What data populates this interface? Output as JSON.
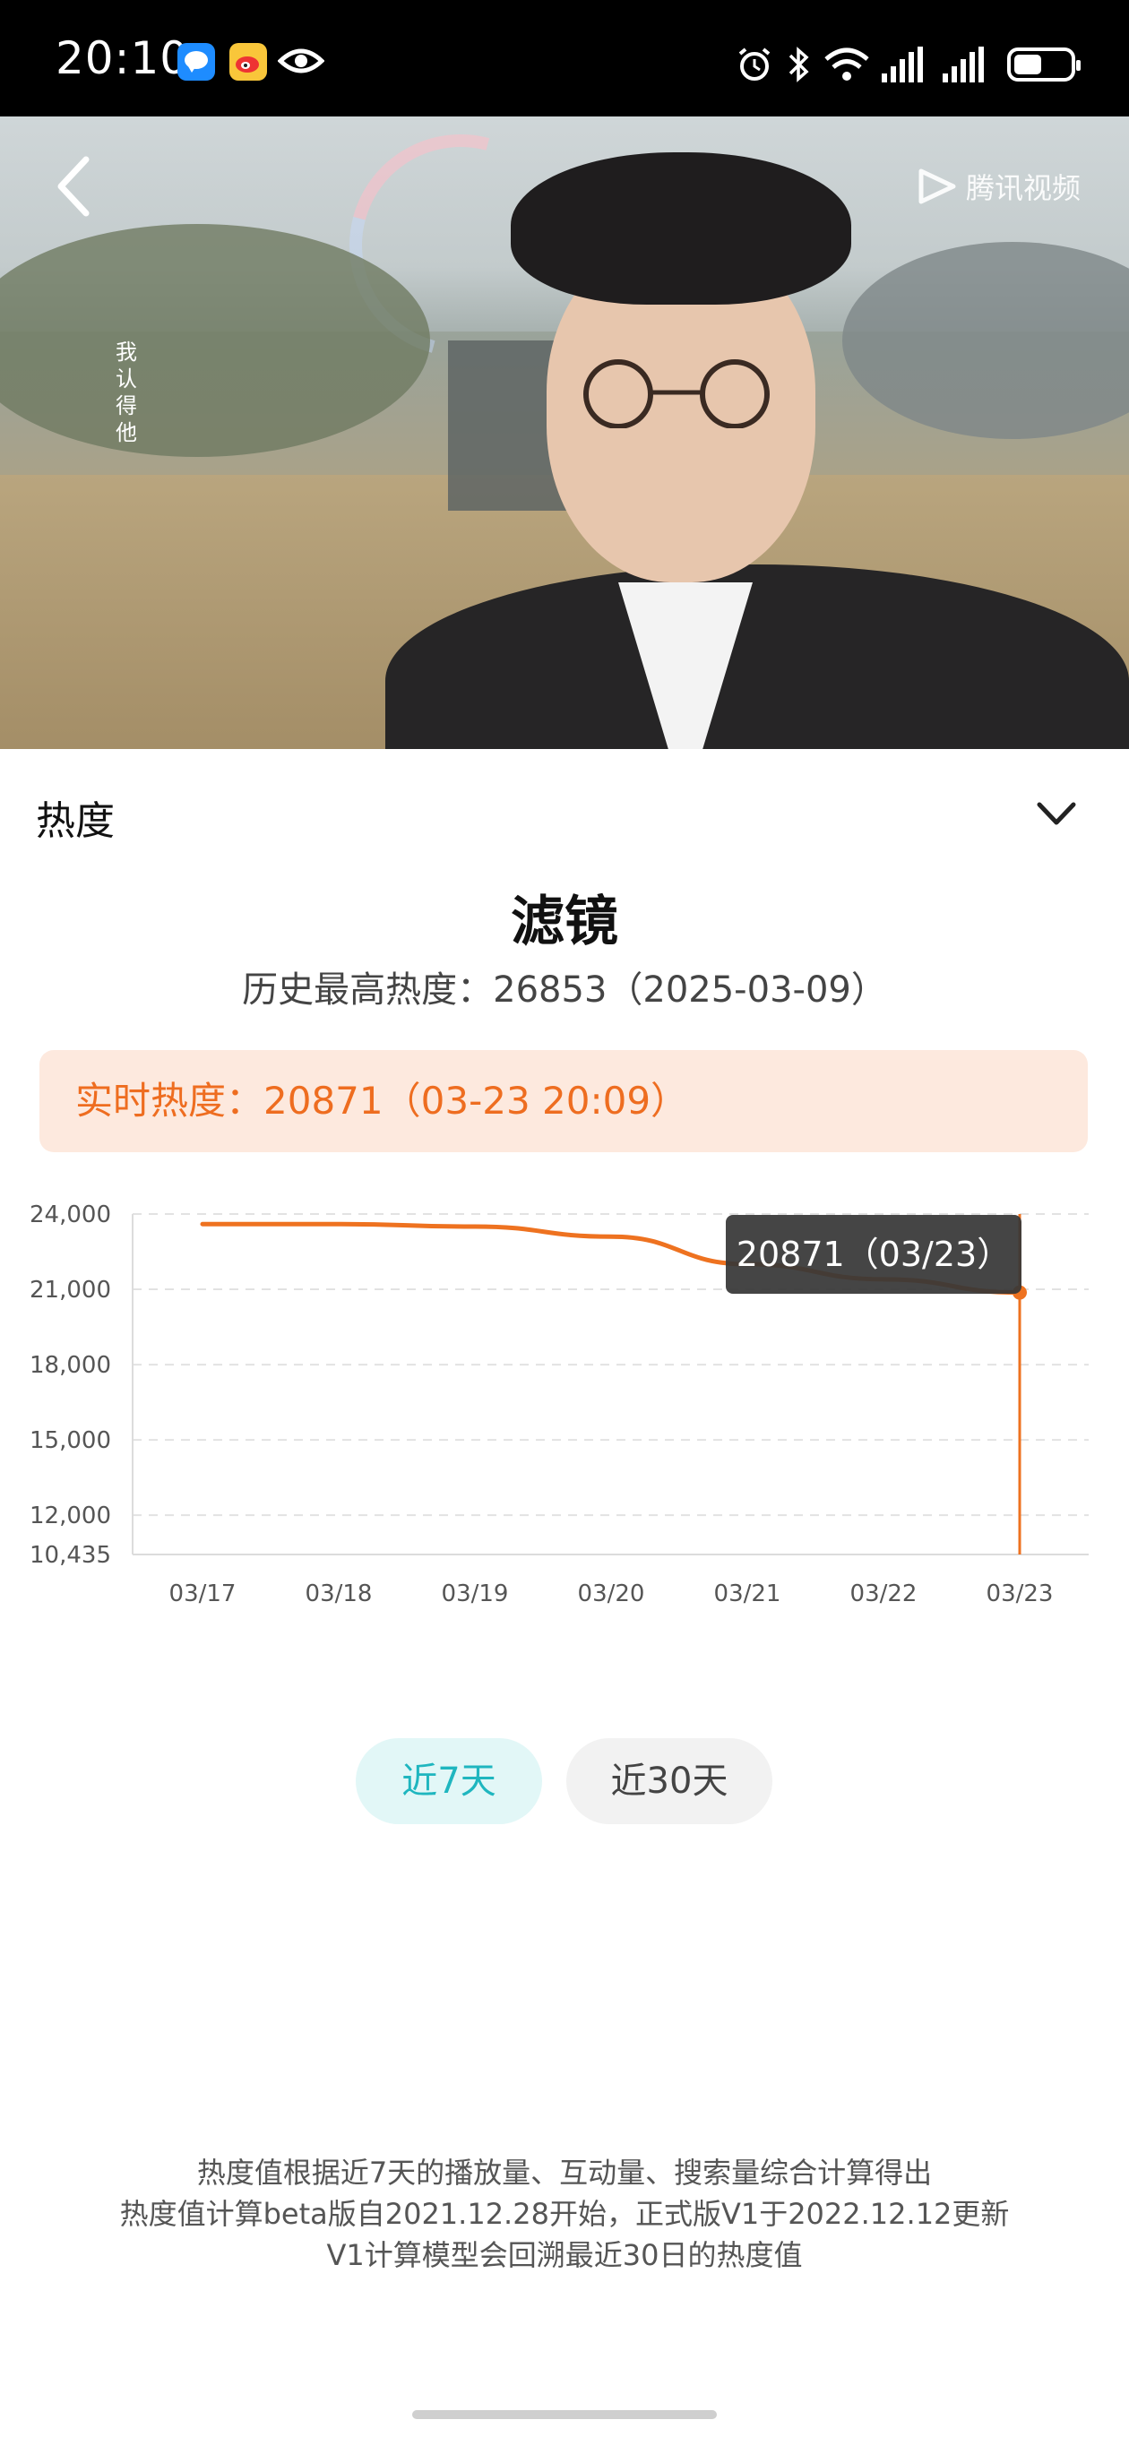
{
  "status_bar": {
    "time": "20:10",
    "icons": [
      "message-app-icon",
      "weibo-icon",
      "eye-icon",
      "alarm-icon",
      "bluetooth-icon",
      "wifi-icon",
      "signal-icon",
      "signal-icon",
      "battery-icon"
    ]
  },
  "hero": {
    "subtitle": "我认得他",
    "watermark": "腾讯视频",
    "back_icon": "chevron-left-icon"
  },
  "section": {
    "title": "热度",
    "toggle_icon": "chevron-down-icon"
  },
  "show": {
    "title": "滤镜",
    "history_label": "历史最高热度：",
    "history_value": "26853（2025-03-09）"
  },
  "realtime": {
    "label": "实时热度：",
    "value": "20871（03-23 20:09）"
  },
  "chart_data": {
    "type": "line",
    "categories": [
      "03/17",
      "03/18",
      "03/19",
      "03/20",
      "03/21",
      "03/22",
      "03/23"
    ],
    "series": [
      {
        "values": [
          23600,
          23600,
          23500,
          23100,
          22000,
          21400,
          20871
        ]
      }
    ],
    "yticks": [
      "24,000",
      "21,000",
      "18,000",
      "15,000",
      "12,000",
      "10,435"
    ],
    "ylim": [
      10435,
      24000
    ],
    "grid": true,
    "line_color": "#ee7220",
    "tooltip": "20871（03/23）"
  },
  "range_buttons": {
    "week": "近7天",
    "month": "近30天"
  },
  "notes": {
    "line1": "热度值根据近7天的播放量、互动量、搜索量综合计算得出",
    "line2": "热度值计算beta版自2021.12.28开始，正式版V1于2022.12.12更新",
    "line3": "V1计算模型会回溯最近30日的热度值"
  }
}
